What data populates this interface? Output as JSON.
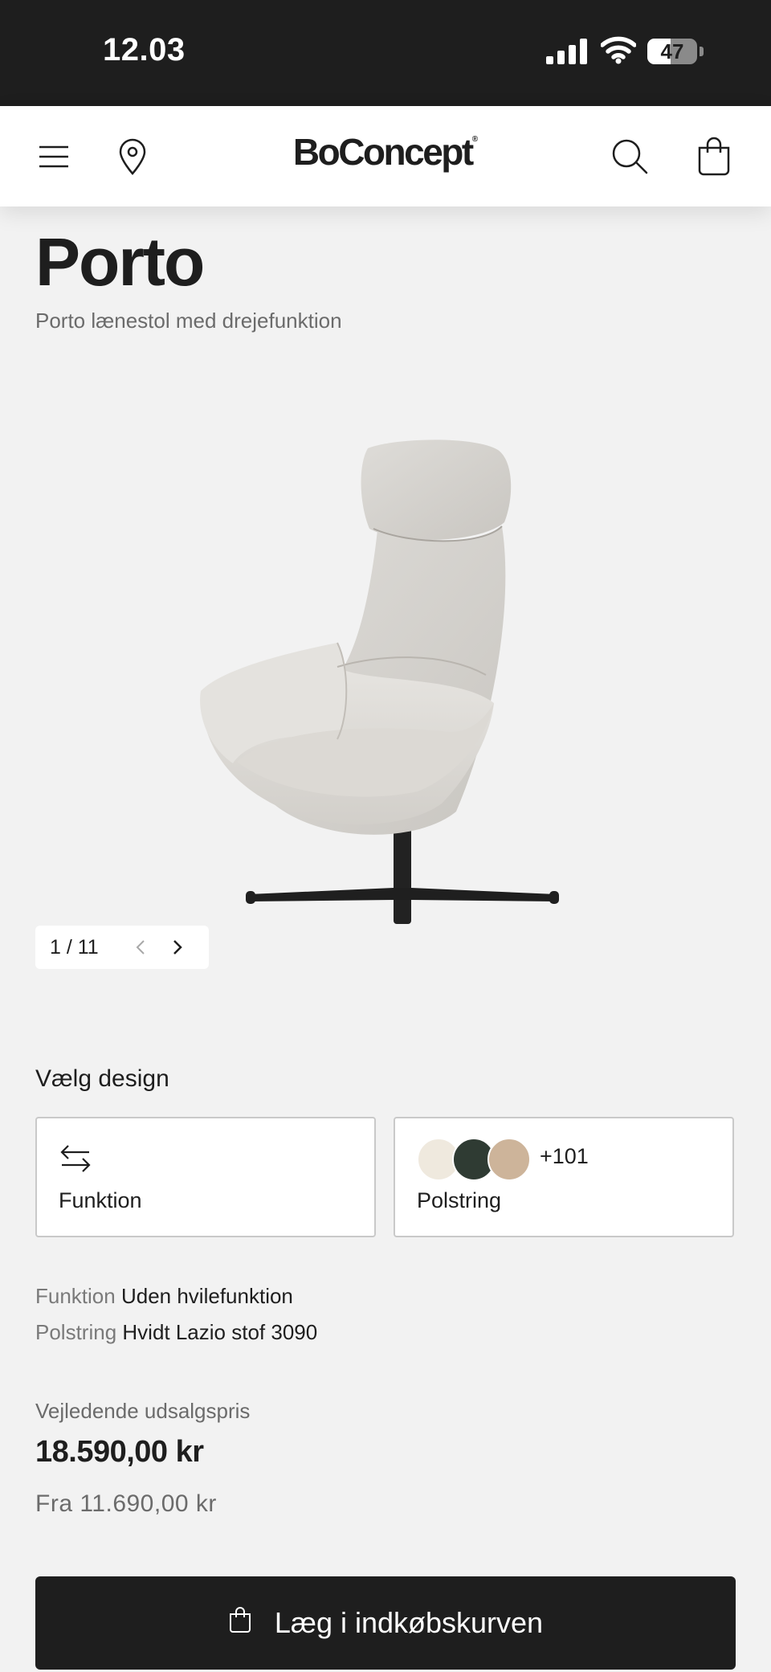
{
  "status_bar": {
    "time": "12.03",
    "battery_percent": "47",
    "battery_level": 0.47
  },
  "header": {
    "logo_text": "BoConcept",
    "logo_mark": "®",
    "icons": [
      "menu-icon",
      "location-pin-icon",
      "search-icon",
      "shopping-bag-icon"
    ]
  },
  "product": {
    "title": "Porto",
    "subtitle": "Porto lænestol med drejefunktion"
  },
  "gallery": {
    "counter": "1 / 11"
  },
  "design": {
    "label": "Vælg design",
    "function_card_label": "Funktion",
    "upholstery_card_label": "Polstring",
    "upholstery_more": "+101",
    "swatch_colors": [
      "#efe9de",
      "#2f3b33",
      "#cdb49a"
    ]
  },
  "selection": {
    "function_key": "Funktion",
    "function_value": "Uden hvilefunktion",
    "upholstery_key": "Polstring",
    "upholstery_value": "Hvidt Lazio stof 3090"
  },
  "pricing": {
    "label": "Vejledende udsalgspris",
    "price": "18.590,00 kr",
    "from_price": "Fra 11.690,00 kr"
  },
  "cart": {
    "button_label": "Læg i indkøbskurven"
  },
  "colors": {
    "dark": "#1e1e1e",
    "background": "#f2f2f2",
    "muted_text": "#6b6b6b"
  }
}
